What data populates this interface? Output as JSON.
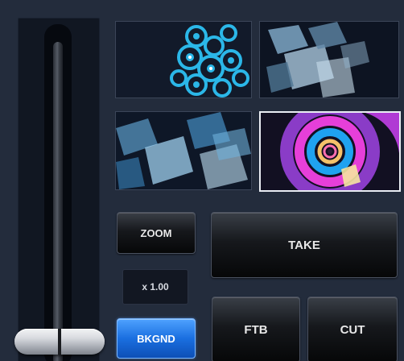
{
  "transition": {
    "zoom_label": "ZOOM",
    "zoom_value": "x 1.00",
    "bkgnd_label": "BKGND",
    "take_label": "TAKE",
    "ftb_label": "FTB",
    "cut_label": "CUT"
  },
  "tbar": {
    "position_fraction": 0
  },
  "colors": {
    "background": "#232c3c",
    "accent_blue": "#1a6fe0",
    "selected_border": "#e9edf3"
  }
}
